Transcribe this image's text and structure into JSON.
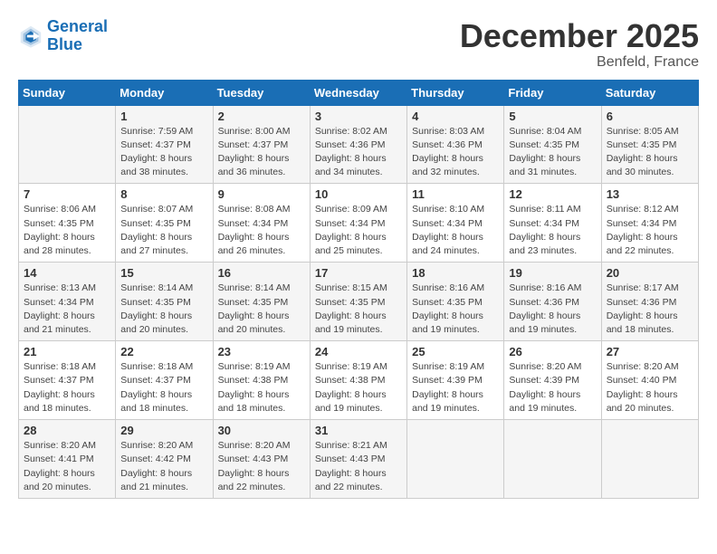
{
  "header": {
    "logo_line1": "General",
    "logo_line2": "Blue",
    "month": "December 2025",
    "location": "Benfeld, France"
  },
  "weekdays": [
    "Sunday",
    "Monday",
    "Tuesday",
    "Wednesday",
    "Thursday",
    "Friday",
    "Saturday"
  ],
  "weeks": [
    [
      {
        "day": "",
        "info": ""
      },
      {
        "day": "1",
        "info": "Sunrise: 7:59 AM\nSunset: 4:37 PM\nDaylight: 8 hours\nand 38 minutes."
      },
      {
        "day": "2",
        "info": "Sunrise: 8:00 AM\nSunset: 4:37 PM\nDaylight: 8 hours\nand 36 minutes."
      },
      {
        "day": "3",
        "info": "Sunrise: 8:02 AM\nSunset: 4:36 PM\nDaylight: 8 hours\nand 34 minutes."
      },
      {
        "day": "4",
        "info": "Sunrise: 8:03 AM\nSunset: 4:36 PM\nDaylight: 8 hours\nand 32 minutes."
      },
      {
        "day": "5",
        "info": "Sunrise: 8:04 AM\nSunset: 4:35 PM\nDaylight: 8 hours\nand 31 minutes."
      },
      {
        "day": "6",
        "info": "Sunrise: 8:05 AM\nSunset: 4:35 PM\nDaylight: 8 hours\nand 30 minutes."
      }
    ],
    [
      {
        "day": "7",
        "info": "Sunrise: 8:06 AM\nSunset: 4:35 PM\nDaylight: 8 hours\nand 28 minutes."
      },
      {
        "day": "8",
        "info": "Sunrise: 8:07 AM\nSunset: 4:35 PM\nDaylight: 8 hours\nand 27 minutes."
      },
      {
        "day": "9",
        "info": "Sunrise: 8:08 AM\nSunset: 4:34 PM\nDaylight: 8 hours\nand 26 minutes."
      },
      {
        "day": "10",
        "info": "Sunrise: 8:09 AM\nSunset: 4:34 PM\nDaylight: 8 hours\nand 25 minutes."
      },
      {
        "day": "11",
        "info": "Sunrise: 8:10 AM\nSunset: 4:34 PM\nDaylight: 8 hours\nand 24 minutes."
      },
      {
        "day": "12",
        "info": "Sunrise: 8:11 AM\nSunset: 4:34 PM\nDaylight: 8 hours\nand 23 minutes."
      },
      {
        "day": "13",
        "info": "Sunrise: 8:12 AM\nSunset: 4:34 PM\nDaylight: 8 hours\nand 22 minutes."
      }
    ],
    [
      {
        "day": "14",
        "info": "Sunrise: 8:13 AM\nSunset: 4:34 PM\nDaylight: 8 hours\nand 21 minutes."
      },
      {
        "day": "15",
        "info": "Sunrise: 8:14 AM\nSunset: 4:35 PM\nDaylight: 8 hours\nand 20 minutes."
      },
      {
        "day": "16",
        "info": "Sunrise: 8:14 AM\nSunset: 4:35 PM\nDaylight: 8 hours\nand 20 minutes."
      },
      {
        "day": "17",
        "info": "Sunrise: 8:15 AM\nSunset: 4:35 PM\nDaylight: 8 hours\nand 19 minutes."
      },
      {
        "day": "18",
        "info": "Sunrise: 8:16 AM\nSunset: 4:35 PM\nDaylight: 8 hours\nand 19 minutes."
      },
      {
        "day": "19",
        "info": "Sunrise: 8:16 AM\nSunset: 4:36 PM\nDaylight: 8 hours\nand 19 minutes."
      },
      {
        "day": "20",
        "info": "Sunrise: 8:17 AM\nSunset: 4:36 PM\nDaylight: 8 hours\nand 18 minutes."
      }
    ],
    [
      {
        "day": "21",
        "info": "Sunrise: 8:18 AM\nSunset: 4:37 PM\nDaylight: 8 hours\nand 18 minutes."
      },
      {
        "day": "22",
        "info": "Sunrise: 8:18 AM\nSunset: 4:37 PM\nDaylight: 8 hours\nand 18 minutes."
      },
      {
        "day": "23",
        "info": "Sunrise: 8:19 AM\nSunset: 4:38 PM\nDaylight: 8 hours\nand 18 minutes."
      },
      {
        "day": "24",
        "info": "Sunrise: 8:19 AM\nSunset: 4:38 PM\nDaylight: 8 hours\nand 19 minutes."
      },
      {
        "day": "25",
        "info": "Sunrise: 8:19 AM\nSunset: 4:39 PM\nDaylight: 8 hours\nand 19 minutes."
      },
      {
        "day": "26",
        "info": "Sunrise: 8:20 AM\nSunset: 4:39 PM\nDaylight: 8 hours\nand 19 minutes."
      },
      {
        "day": "27",
        "info": "Sunrise: 8:20 AM\nSunset: 4:40 PM\nDaylight: 8 hours\nand 20 minutes."
      }
    ],
    [
      {
        "day": "28",
        "info": "Sunrise: 8:20 AM\nSunset: 4:41 PM\nDaylight: 8 hours\nand 20 minutes."
      },
      {
        "day": "29",
        "info": "Sunrise: 8:20 AM\nSunset: 4:42 PM\nDaylight: 8 hours\nand 21 minutes."
      },
      {
        "day": "30",
        "info": "Sunrise: 8:20 AM\nSunset: 4:43 PM\nDaylight: 8 hours\nand 22 minutes."
      },
      {
        "day": "31",
        "info": "Sunrise: 8:21 AM\nSunset: 4:43 PM\nDaylight: 8 hours\nand 22 minutes."
      },
      {
        "day": "",
        "info": ""
      },
      {
        "day": "",
        "info": ""
      },
      {
        "day": "",
        "info": ""
      }
    ]
  ]
}
